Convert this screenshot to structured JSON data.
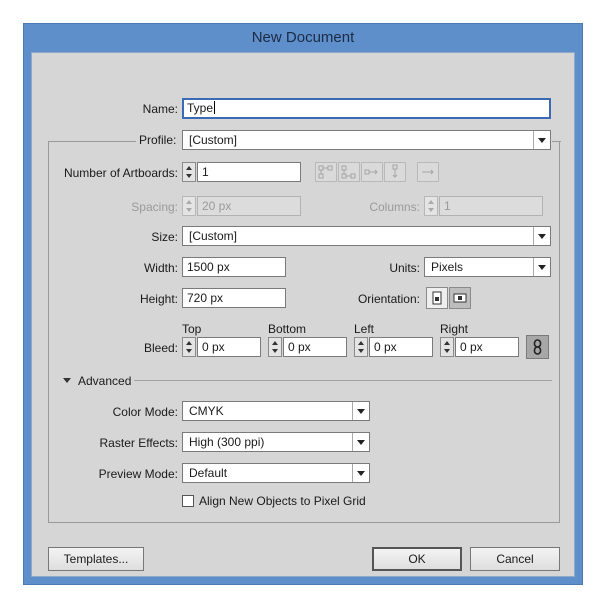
{
  "window": {
    "title": "New Document"
  },
  "name": {
    "label": "Name:",
    "value": "Type"
  },
  "profile": {
    "label": "Profile:",
    "value": "[Custom]"
  },
  "artboards": {
    "count_label": "Number of Artboards:",
    "count_value": "1",
    "spacing_label": "Spacing:",
    "spacing_value": "20 px",
    "columns_label": "Columns:",
    "columns_value": "1"
  },
  "size": {
    "label": "Size:",
    "value": "[Custom]"
  },
  "width": {
    "label": "Width:",
    "value": "1500 px"
  },
  "units": {
    "label": "Units:",
    "value": "Pixels"
  },
  "height": {
    "label": "Height:",
    "value": "720 px"
  },
  "orientation": {
    "label": "Orientation:"
  },
  "bleed": {
    "label": "Bleed:",
    "top_label": "Top",
    "top_value": "0 px",
    "bottom_label": "Bottom",
    "bottom_value": "0 px",
    "left_label": "Left",
    "left_value": "0 px",
    "right_label": "Right",
    "right_value": "0 px"
  },
  "advanced": {
    "label": "Advanced",
    "color_mode_label": "Color Mode:",
    "color_mode_value": "CMYK",
    "raster_label": "Raster Effects:",
    "raster_value": "High (300 ppi)",
    "preview_label": "Preview Mode:",
    "preview_value": "Default",
    "align_label": "Align New Objects to Pixel Grid"
  },
  "buttons": {
    "templates": "Templates...",
    "ok": "OK",
    "cancel": "Cancel"
  },
  "colors": {
    "titlebar": "#5f8fcb",
    "dialog_bg": "#d6d6d6",
    "focus_border": "#3c6bb5"
  }
}
